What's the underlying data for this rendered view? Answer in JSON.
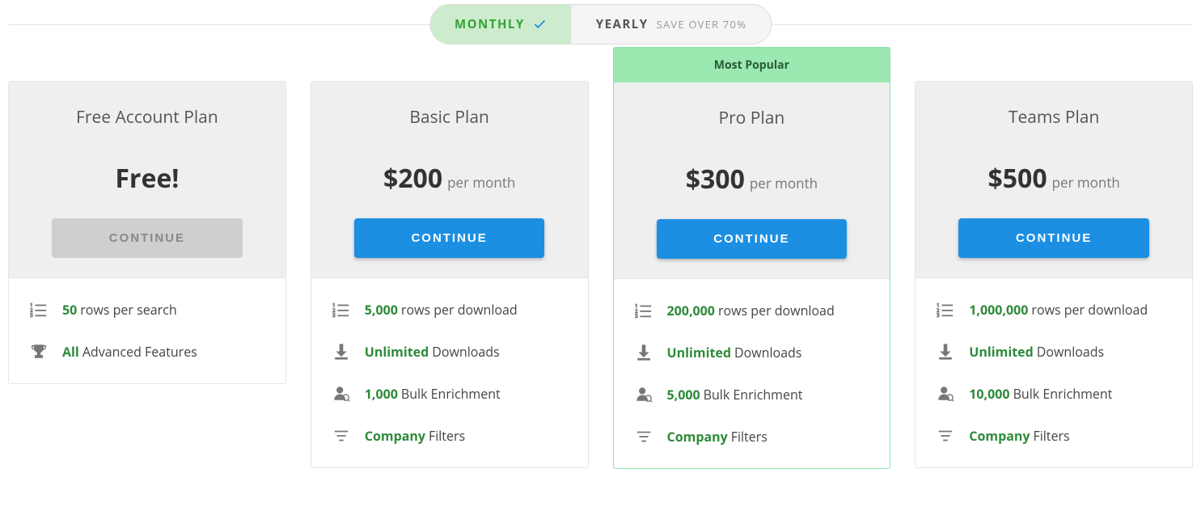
{
  "toggle": {
    "monthly": "MONTHLY",
    "yearly": "YEARLY",
    "yearly_sub": "SAVE OVER 70%"
  },
  "popular_badge": "Most Popular",
  "plans": [
    {
      "name": "Free Account Plan",
      "price": "Free!",
      "per": "",
      "cta": "CONTINUE",
      "cta_style": "grey",
      "features": [
        {
          "icon": "list",
          "highlight": "50",
          "rest": "rows per search"
        },
        {
          "icon": "trophy",
          "highlight": "All",
          "rest": "Advanced Features"
        }
      ]
    },
    {
      "name": "Basic Plan",
      "price": "$200",
      "per": "per month",
      "cta": "CONTINUE",
      "cta_style": "blue",
      "features": [
        {
          "icon": "list",
          "highlight": "5,000",
          "rest": "rows per download"
        },
        {
          "icon": "download",
          "highlight": "Unlimited",
          "rest": "Downloads"
        },
        {
          "icon": "person",
          "highlight": "1,000",
          "rest": "Bulk Enrichment"
        },
        {
          "icon": "filter",
          "highlight": "Company",
          "rest": "Filters"
        }
      ]
    },
    {
      "name": "Pro Plan",
      "price": "$300",
      "per": "per month",
      "cta": "CONTINUE",
      "cta_style": "blue",
      "popular": true,
      "features": [
        {
          "icon": "list",
          "highlight": "200,000",
          "rest": "rows per download"
        },
        {
          "icon": "download",
          "highlight": "Unlimited",
          "rest": "Downloads"
        },
        {
          "icon": "person",
          "highlight": "5,000",
          "rest": "Bulk Enrichment"
        },
        {
          "icon": "filter",
          "highlight": "Company",
          "rest": "Filters"
        }
      ]
    },
    {
      "name": "Teams Plan",
      "price": "$500",
      "per": "per month",
      "cta": "CONTINUE",
      "cta_style": "blue",
      "features": [
        {
          "icon": "list",
          "highlight": "1,000,000",
          "rest": "rows per download"
        },
        {
          "icon": "download",
          "highlight": "Unlimited",
          "rest": "Downloads"
        },
        {
          "icon": "person",
          "highlight": "10,000",
          "rest": "Bulk Enrichment"
        },
        {
          "icon": "filter",
          "highlight": "Company",
          "rest": "Filters"
        }
      ]
    }
  ]
}
